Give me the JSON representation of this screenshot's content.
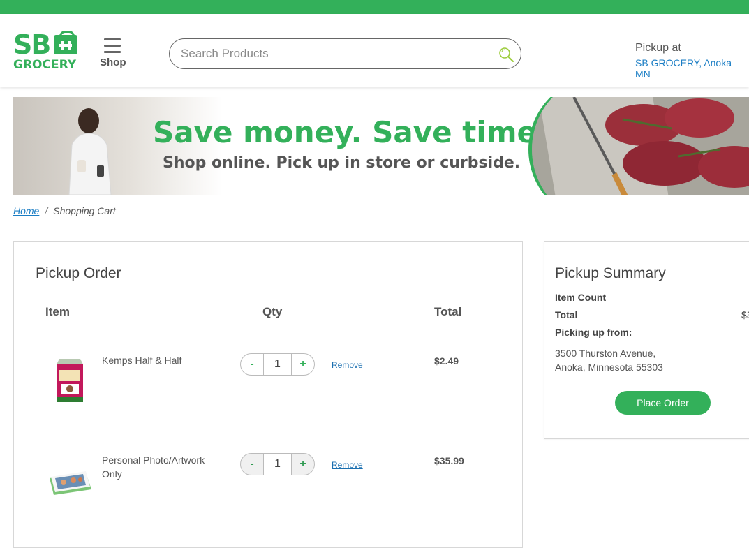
{
  "header": {
    "logo": {
      "line1": "SB",
      "line2": "GROCERY"
    },
    "menu_label": "Shop",
    "search": {
      "placeholder": "Search Products",
      "value": ""
    },
    "pickup": {
      "label": "Pickup at",
      "store": "SB GROCERY, Anoka MN"
    }
  },
  "banner": {
    "headline": "Save money. Save time.",
    "subline": "Shop online. Pick up in store or curbside."
  },
  "breadcrumb": {
    "home": "Home",
    "separator": "/",
    "current": "Shopping Cart"
  },
  "order": {
    "title": "Pickup Order",
    "columns": {
      "item": "Item",
      "qty": "Qty",
      "total": "Total"
    },
    "items": [
      {
        "name": "Kemps Half & Half",
        "qty": "1",
        "minus": "-",
        "plus": "+",
        "remove": "Remove",
        "total": "$2.49"
      },
      {
        "name": "Personal Photo/Artwork Only",
        "qty": "1",
        "minus": "-",
        "plus": "+",
        "remove": "Remove",
        "total": "$35.99"
      }
    ]
  },
  "summary": {
    "title": "Pickup Summary",
    "item_count_label": "Item Count",
    "total_label": "Total",
    "total_value": "$3",
    "picking_label": "Picking up from:",
    "address_line1": "3500 Thurston Avenue,",
    "address_line2": "Anoka, Minnesota 55303",
    "place_order": "Place Order"
  },
  "colors": {
    "brand_green": "#33b05a",
    "link_blue": "#1a7dc4"
  },
  "icons": {
    "search": "search-icon",
    "menu": "hamburger-icon",
    "logo_bag": "grocery-bag-icon"
  }
}
